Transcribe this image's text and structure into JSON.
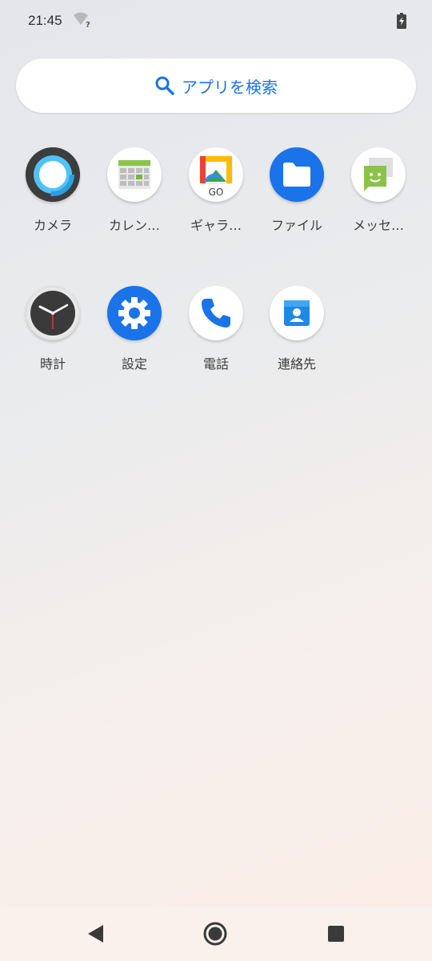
{
  "status_bar": {
    "time": "21:45",
    "wifi_icon": "wifi-unknown-icon",
    "battery_icon": "battery-charging-icon"
  },
  "search": {
    "placeholder": "アプリを検索",
    "icon": "search-icon",
    "accent_color": "#1a73e8"
  },
  "apps": [
    {
      "label": "カメラ",
      "icon": "camera-icon"
    },
    {
      "label": "カレン…",
      "icon": "calendar-icon"
    },
    {
      "label": "ギャラ…",
      "icon": "gallery-go-icon"
    },
    {
      "label": "ファイル",
      "icon": "files-icon"
    },
    {
      "label": "メッセ…",
      "icon": "messages-icon"
    },
    {
      "label": "時計",
      "icon": "clock-icon"
    },
    {
      "label": "設定",
      "icon": "settings-icon"
    },
    {
      "label": "電話",
      "icon": "phone-icon"
    },
    {
      "label": "連絡先",
      "icon": "contacts-icon"
    }
  ],
  "gallery_badge": "GO",
  "nav_bar": {
    "back_icon": "back-triangle-icon",
    "home_icon": "home-circle-icon",
    "recents_icon": "recents-square-icon"
  }
}
